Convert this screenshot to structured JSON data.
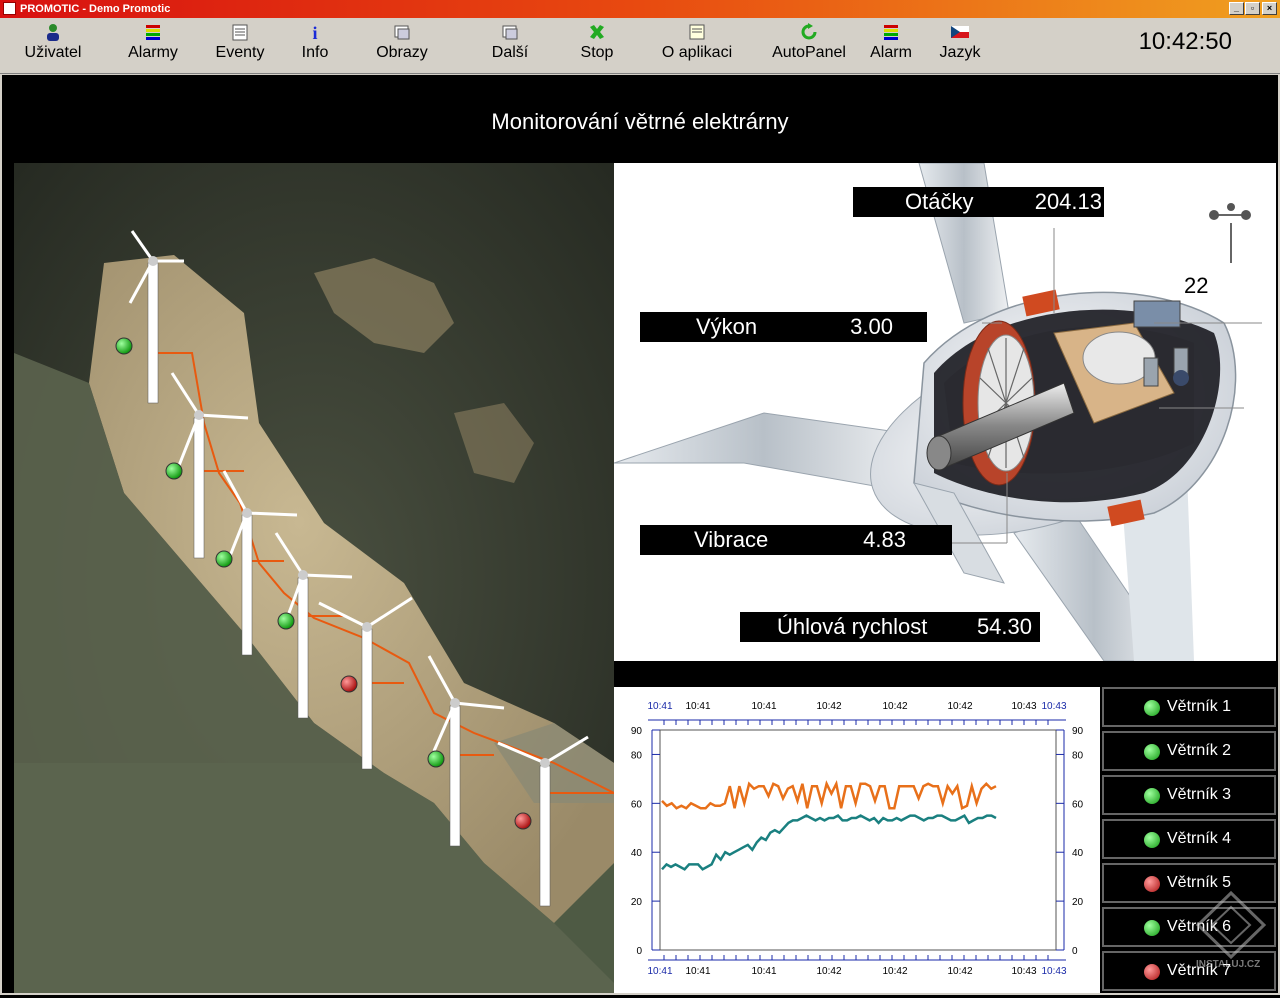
{
  "window": {
    "title": "PROMOTIC - Demo Promotic"
  },
  "toolbar": {
    "items": [
      {
        "label": "Uživatel",
        "icon": "user-icon"
      },
      {
        "label": "Alarmy",
        "icon": "alarms-icon"
      },
      {
        "label": "Eventy",
        "icon": "events-icon"
      },
      {
        "label": "Info",
        "icon": "info-icon"
      },
      {
        "label": "Obrazy",
        "icon": "screens-icon"
      },
      {
        "label": "Další",
        "icon": "next-icon"
      },
      {
        "label": "Stop",
        "icon": "stop-icon"
      },
      {
        "label": "O aplikaci",
        "icon": "about-icon"
      },
      {
        "label": "AutoPanel",
        "icon": "autopanel-icon"
      },
      {
        "label": "Alarm",
        "icon": "alarm-icon"
      },
      {
        "label": "Jazyk",
        "icon": "czech-flag-icon"
      }
    ],
    "clock": "10:42:50"
  },
  "page": {
    "title": "Monitorování větrné elektrárny"
  },
  "map": {
    "turbine_status": [
      "ok",
      "ok",
      "ok",
      "ok",
      "fault",
      "ok",
      "fault"
    ]
  },
  "turbine": {
    "callout": "22",
    "readouts": {
      "otacky": {
        "label": "Otáčky",
        "value": "204.13"
      },
      "vykon": {
        "label": "Výkon",
        "value": "3.00"
      },
      "vibrace": {
        "label": "Vibrace",
        "value": "4.83"
      },
      "uhlova": {
        "label": "Úhlová rychlost",
        "value": "54.30"
      }
    }
  },
  "chart_data": {
    "type": "line",
    "x_tick_labels": [
      "10:41",
      "10:41",
      "10:41",
      "10:42",
      "10:42",
      "10:42",
      "10:43",
      "10:43"
    ],
    "y_ticks": [
      0,
      20,
      40,
      60,
      80,
      90
    ],
    "ylim": [
      0,
      90
    ],
    "series": [
      {
        "color": "#e8701a",
        "values": [
          61,
          59,
          60,
          58,
          59,
          58,
          60,
          59,
          58,
          58,
          60,
          59,
          59,
          60,
          67,
          58,
          67,
          60,
          68,
          66,
          67,
          67,
          63,
          68,
          67,
          62,
          66,
          67,
          61,
          68,
          58,
          67,
          67,
          60,
          68,
          64,
          68,
          58,
          67,
          67,
          60,
          68,
          68,
          67,
          61,
          67,
          67,
          58,
          58,
          67,
          67,
          67,
          67,
          62,
          67,
          68,
          67,
          67,
          60,
          67,
          64,
          67,
          58,
          59,
          67,
          60,
          66,
          68,
          66,
          67
        ]
      },
      {
        "color": "#1a8080",
        "values": [
          33,
          35,
          34,
          35,
          34,
          33,
          35,
          35,
          35,
          33,
          34,
          35,
          39,
          37,
          40,
          39,
          40,
          41,
          42,
          43,
          41,
          44,
          46,
          45,
          48,
          49,
          48,
          50,
          52,
          53,
          53,
          54,
          55,
          54,
          53,
          54,
          53,
          54,
          54,
          55,
          53,
          53,
          54,
          54,
          55,
          54,
          53,
          54,
          52,
          54,
          53,
          53,
          54,
          53,
          54,
          55,
          55,
          54,
          53,
          54,
          54,
          55,
          55,
          54,
          53,
          53,
          54,
          55,
          52,
          53,
          54,
          54,
          55,
          55,
          54
        ]
      }
    ]
  },
  "legend": {
    "items": [
      {
        "label": "Větrník 1",
        "status": "ok"
      },
      {
        "label": "Větrník 2",
        "status": "ok"
      },
      {
        "label": "Větrník 3",
        "status": "ok"
      },
      {
        "label": "Větrník 4",
        "status": "ok"
      },
      {
        "label": "Větrník 5",
        "status": "fault"
      },
      {
        "label": "Větrník 6",
        "status": "ok"
      },
      {
        "label": "Větrník 7",
        "status": "fault"
      }
    ]
  },
  "colors": {
    "ok": "#22cc22",
    "fault": "#dd1111",
    "route": "#e85a10"
  },
  "watermark": "INSTALUJ.CZ"
}
